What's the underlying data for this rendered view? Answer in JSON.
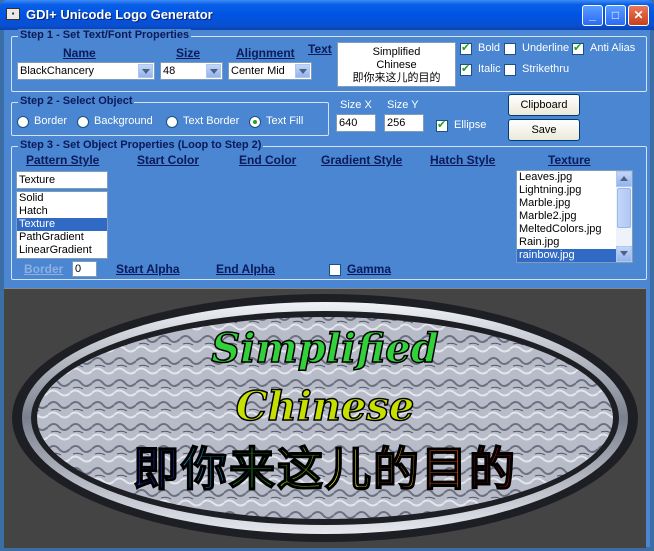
{
  "window": {
    "title": "GDI+ Unicode Logo Generator"
  },
  "title_buttons": {
    "minimize": "_",
    "maximize": "□",
    "close": "✕"
  },
  "step1": {
    "legend": "Step 1 - Set Text/Font Properties",
    "name_label": "Name",
    "name_value": "BlackChancery",
    "size_label": "Size",
    "size_value": "48",
    "alignment_label": "Alignment",
    "alignment_value": "Center Mid",
    "text_label": "Text",
    "text_line1": "Simplified",
    "text_line2": "Chinese",
    "text_line3": "即你来这儿的目的",
    "bold": {
      "label": "Bold",
      "checked": true
    },
    "underline": {
      "label": "Underline",
      "checked": false
    },
    "anti_alias": {
      "label": "Anti Alias",
      "checked": true
    },
    "italic": {
      "label": "Italic",
      "checked": true
    },
    "strikethru": {
      "label": "Strikethru",
      "checked": false
    }
  },
  "step2": {
    "legend": "Step 2 - Select Object",
    "options": [
      {
        "label": "Border",
        "checked": false
      },
      {
        "label": "Background",
        "checked": false
      },
      {
        "label": "Text Border",
        "checked": false
      },
      {
        "label": "Text Fill",
        "checked": true
      }
    ],
    "size_x_label": "Size X",
    "size_x_value": "640",
    "size_y_label": "Size Y",
    "size_y_value": "256",
    "ellipse": {
      "label": "Ellipse",
      "checked": true
    }
  },
  "buttons": {
    "clipboard": "Clipboard",
    "save": "Save"
  },
  "step3": {
    "legend": "Step 3 - Set Object Properties (Loop to Step 2)",
    "headers": {
      "pattern_style": "Pattern Style",
      "start_color": "Start Color",
      "end_color": "End Color",
      "gradient_style": "Gradient Style",
      "hatch_style": "Hatch Style",
      "texture": "Texture"
    },
    "pattern_input": "Texture",
    "pattern_items": [
      "Solid",
      "Hatch",
      "Texture",
      "PathGradient",
      "LinearGradient"
    ],
    "pattern_selected": 2,
    "texture_items": [
      "Leaves.jpg",
      "Lightning.jpg",
      "Marble.jpg",
      "Marble2.jpg",
      "MeltedColors.jpg",
      "Rain.jpg",
      "rainbow.jpg"
    ],
    "texture_selected": 6,
    "border_label": "Border",
    "border_value": "0",
    "start_alpha": "Start Alpha",
    "end_alpha": "End Alpha",
    "gamma": {
      "label": "Gamma",
      "checked": false
    }
  },
  "preview": {
    "line1": "Simplified",
    "line2": "Chinese",
    "line3": "即你来这儿的目的",
    "line3_colors": [
      "#2233cc",
      "#1ea6e0",
      "#22aa22",
      "#7fcc10",
      "#e8e020",
      "#f0a010",
      "#e85a10",
      "#d01010"
    ],
    "background_color": "#444444",
    "ellipse_fill_color": "#b8bcc8"
  }
}
